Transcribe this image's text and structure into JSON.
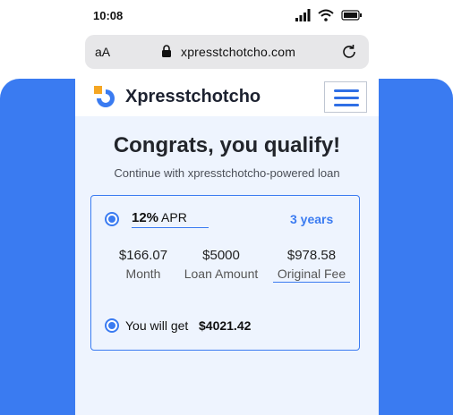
{
  "status_bar": {
    "time": "10:08"
  },
  "browser": {
    "text_size_label": "aA",
    "url": "xpresstchotcho.com"
  },
  "site": {
    "brand": "Xpresstchotcho"
  },
  "content": {
    "headline": "Congrats, you qualify!",
    "subline": "Continue with xpresstchotcho-powered loan"
  },
  "offer": {
    "apr_value": "12%",
    "apr_label": "APR",
    "term": "3 years",
    "monthly": {
      "value": "$166.07",
      "label": "Month"
    },
    "loan_amount": {
      "value": "$5000",
      "label": "Loan Amount"
    },
    "fee": {
      "value": "$978.58",
      "label": "Original Fee"
    },
    "get_label": "You will get",
    "get_amount": "$4021.42"
  },
  "colors": {
    "accent": "#3a7bf1",
    "page_bg": "#eef4fe",
    "logo_orange": "#f5a623"
  }
}
